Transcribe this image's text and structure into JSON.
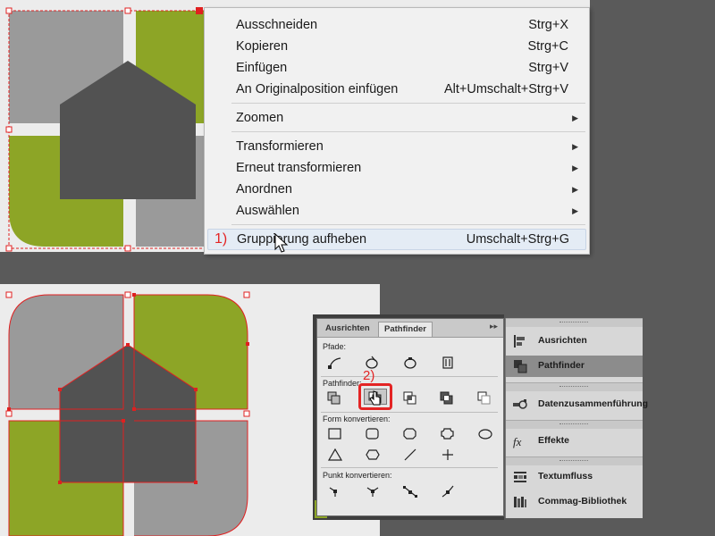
{
  "context_menu": {
    "items": [
      {
        "label": "Ausschneiden",
        "shortcut": "Strg+X"
      },
      {
        "label": "Kopieren",
        "shortcut": "Strg+C"
      },
      {
        "label": "Einfügen",
        "shortcut": "Strg+V"
      },
      {
        "label": "An Originalposition einfügen",
        "shortcut": "Alt+Umschalt+Strg+V"
      },
      {
        "label": "Zoomen",
        "submenu": true
      },
      {
        "label": "Transformieren",
        "submenu": true
      },
      {
        "label": "Erneut transformieren",
        "submenu": true
      },
      {
        "label": "Anordnen",
        "submenu": true
      },
      {
        "label": "Auswählen",
        "submenu": true
      },
      {
        "label": "Gruppierung aufheben",
        "shortcut": "Umschalt+Strg+G",
        "highlighted": true
      }
    ],
    "step_marker": "1)"
  },
  "pathfinder_panel": {
    "tabs": [
      "Ausrichten",
      "Pathfinder"
    ],
    "active_tab": "Pathfinder",
    "collapse_glyph": "▸▸",
    "sections": {
      "pfade": "Pfade:",
      "pathfinder": "Pathfinder:",
      "form": "Form konvertieren:",
      "punkt": "Punkt konvertieren:"
    },
    "step_marker": "2)"
  },
  "dock_panel": {
    "items": [
      {
        "label": "Ausrichten",
        "icon": "align-icon"
      },
      {
        "label": "Pathfinder",
        "icon": "pathfinder-icon",
        "selected": true
      },
      {
        "label": "Datenzusammenführung",
        "icon": "data-merge-icon"
      },
      {
        "label": "Effekte",
        "icon": "fx-icon"
      },
      {
        "label": "Textumfluss",
        "icon": "text-wrap-icon"
      },
      {
        "label": "Commag-Bibliothek",
        "icon": "library-icon"
      }
    ]
  },
  "colors": {
    "green": "#8da526",
    "gray_dark": "#525252",
    "gray_light": "#9a9a9a",
    "selection_red": "#e02020",
    "step_red": "#e32424"
  }
}
